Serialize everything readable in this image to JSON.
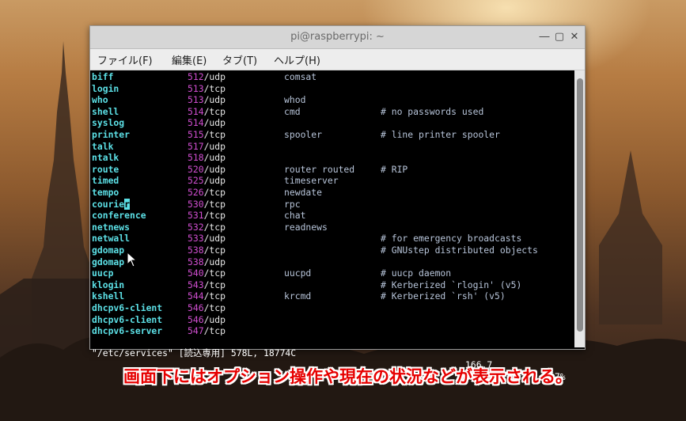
{
  "window": {
    "title": "pi@raspberrypi: ~",
    "buttons": {
      "minimize": "―",
      "maximize": "▢",
      "close": "✕"
    }
  },
  "menubar": {
    "file": "ファイル(F)",
    "edit": "編集(E)",
    "tabs": "タブ(T)",
    "help": "ヘルプ(H)"
  },
  "rows": [
    {
      "name": "biff",
      "port": "512",
      "proto": "/udp",
      "alias": "comsat",
      "comment": ""
    },
    {
      "name": "login",
      "port": "513",
      "proto": "/tcp",
      "alias": "",
      "comment": ""
    },
    {
      "name": "who",
      "port": "513",
      "proto": "/udp",
      "alias": "whod",
      "comment": ""
    },
    {
      "name": "shell",
      "port": "514",
      "proto": "/tcp",
      "alias": "cmd",
      "comment": "# no passwords used"
    },
    {
      "name": "syslog",
      "port": "514",
      "proto": "/udp",
      "alias": "",
      "comment": ""
    },
    {
      "name": "printer",
      "port": "515",
      "proto": "/tcp",
      "alias": "spooler",
      "comment": "# line printer spooler"
    },
    {
      "name": "talk",
      "port": "517",
      "proto": "/udp",
      "alias": "",
      "comment": ""
    },
    {
      "name": "ntalk",
      "port": "518",
      "proto": "/udp",
      "alias": "",
      "comment": ""
    },
    {
      "name": "route",
      "port": "520",
      "proto": "/udp",
      "alias": "router routed",
      "comment": "# RIP"
    },
    {
      "name": "timed",
      "port": "525",
      "proto": "/udp",
      "alias": "timeserver",
      "comment": ""
    },
    {
      "name": "tempo",
      "port": "526",
      "proto": "/tcp",
      "alias": "newdate",
      "comment": ""
    },
    {
      "name": "courier",
      "port": "530",
      "proto": "/tcp",
      "alias": "rpc",
      "comment": ""
    },
    {
      "name": "conference",
      "port": "531",
      "proto": "/tcp",
      "alias": "chat",
      "comment": ""
    },
    {
      "name": "netnews",
      "port": "532",
      "proto": "/tcp",
      "alias": "readnews",
      "comment": ""
    },
    {
      "name": "netwall",
      "port": "533",
      "proto": "/udp",
      "alias": "",
      "comment": "# for emergency broadcasts"
    },
    {
      "name": "gdomap",
      "port": "538",
      "proto": "/tcp",
      "alias": "",
      "comment": "# GNUstep distributed objects"
    },
    {
      "name": "gdomap",
      "port": "538",
      "proto": "/udp",
      "alias": "",
      "comment": ""
    },
    {
      "name": "uucp",
      "port": "540",
      "proto": "/tcp",
      "alias": "uucpd",
      "comment": "# uucp daemon"
    },
    {
      "name": "klogin",
      "port": "543",
      "proto": "/tcp",
      "alias": "",
      "comment": "# Kerberized `rlogin' (v5)"
    },
    {
      "name": "kshell",
      "port": "544",
      "proto": "/tcp",
      "alias": "krcmd",
      "comment": "# Kerberized `rsh' (v5)"
    },
    {
      "name": "dhcpv6-client",
      "port": "546",
      "proto": "/tcp",
      "alias": "",
      "comment": ""
    },
    {
      "name": "dhcpv6-client",
      "port": "546",
      "proto": "/udp",
      "alias": "",
      "comment": ""
    },
    {
      "name": "dhcpv6-server",
      "port": "547",
      "proto": "/tcp",
      "alias": "",
      "comment": ""
    }
  ],
  "status": {
    "file": "\"/etc/services\" [読込専用] 578L, 18774C",
    "position": "166,7",
    "percent": "27%"
  },
  "caption": "画面下にはオプション操作や現在の状況などが表示される。",
  "colors": {
    "cyan": "#5ce0e6",
    "magenta": "#d24fd2",
    "caption_red": "#e60000"
  }
}
